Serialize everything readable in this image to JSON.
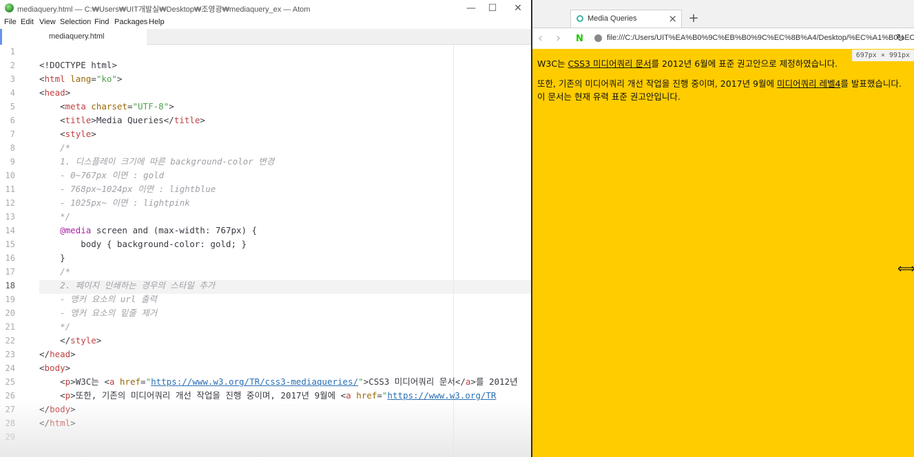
{
  "atom": {
    "window_title": "mediaquery.html — C:₩Users₩UIT개발실₩Desktop₩조영광₩mediaquery_ex — Atom",
    "menu": [
      "File",
      "Edit",
      "View",
      "Selection",
      "Find",
      "Packages",
      "Help"
    ],
    "tab_title": "mediaquery.html",
    "window_buttons": {
      "minimize": "—",
      "maximize": "☐",
      "close": "✕"
    },
    "line_numbers": [
      "1",
      "2",
      "3",
      "4",
      "5",
      "6",
      "7",
      "8",
      "9",
      "10",
      "11",
      "12",
      "13",
      "14",
      "15",
      "16",
      "17",
      "18",
      "19",
      "20",
      "21",
      "22",
      "23",
      "24",
      "25",
      "26",
      "27",
      "28",
      "29"
    ],
    "code": {
      "doctype": "<!DOCTYPE html>",
      "html_tag": "html",
      "lang_attr": "lang",
      "lang_val": "\"ko\"",
      "head_tag": "head",
      "meta_tag": "meta",
      "charset_attr": "charset",
      "charset_val": "\"UTF-8\"",
      "title_tag": "title",
      "title_text": "Media Queries",
      "style_tag": "style",
      "c_open": "/*",
      "c1": "1. 디스플레이 크기에 따른 background-color 변경",
      "c2": "- 0~767px 이면 : gold",
      "c3": "- 768px~1024px 이면 : lightblue",
      "c4": "- 1025px~ 이면 : lightpink",
      "c_close": "*/",
      "media_kw": "@media",
      "media_rest": " screen and (max-width: 767px) {",
      "body_rule": "body { background-color: gold; }",
      "close_brace": "}",
      "c5": "2. 페이지 인쇄하는 경우의 스타일 추가",
      "c6": "- 앵커 요소의 url 출력",
      "c7": "- 앵커 요소의 밑줄 제거",
      "body_tag": "body",
      "p_tag": "p",
      "a_tag": "a",
      "href_attr": "href",
      "url1": "https://www.w3.org/TR/css3-mediaqueries/",
      "line25_text1": "W3C는 ",
      "line25_text2": "CSS3 미디어쿼리 문서",
      "line25_text3": "를 2012년",
      "line26_text1": "또한, 기존의 미디어쿼리 개선 작업을 진행 중이며, 2017년 9월에 ",
      "url2_partial": "https://www.w3.org/TR"
    }
  },
  "browser": {
    "tab_title": "Media Queries",
    "tab_close": "×",
    "new_tab": "+",
    "back": "‹",
    "forward": "›",
    "naver_logo": "N",
    "url": "file:///C:/Users/UIT%EA%B0%9C%EB%B0%9C%EC%8B%A4/Desktop/%EC%A1%B0%EC",
    "reload": "↻",
    "size_overlay": "697px × 991px",
    "p1_prefix": "W3C는 ",
    "p1_link": "CSS3 미디어쿼리 문서",
    "p1_suffix": "를 2012년 6월에 표준 권고안으로 제정하였습니다.",
    "p2_prefix": "또한, 기존의 미디어쿼리 개선 작업을 진행 중이며, 2017년 9월에 ",
    "p2_link": "미디어쿼리 레벨4",
    "p2_suffix": "를 발표했습니다. 이 문서는 현재 유력 표준 권고안입니다.",
    "page_background": "#ffcc00"
  }
}
